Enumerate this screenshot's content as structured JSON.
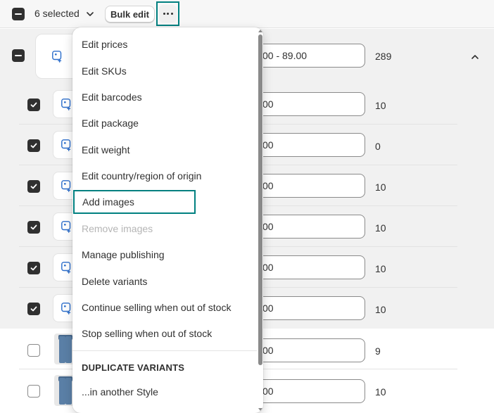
{
  "toolbar": {
    "selected_label": "6 selected",
    "bulk_edit_label": "Bulk edit"
  },
  "parent": {
    "price": "00 - 89.00",
    "qty": "289"
  },
  "variants": [
    {
      "checked": true,
      "image": "add-image",
      "price": "00",
      "qty": "10"
    },
    {
      "checked": true,
      "image": "add-image",
      "price": "00",
      "qty": "0"
    },
    {
      "checked": true,
      "image": "add-image",
      "price": "00",
      "qty": "10"
    },
    {
      "checked": true,
      "image": "add-image",
      "price": "00",
      "qty": "10"
    },
    {
      "checked": true,
      "image": "add-image",
      "price": "00",
      "qty": "10"
    },
    {
      "checked": true,
      "image": "add-image",
      "price": "00",
      "qty": "10"
    },
    {
      "checked": false,
      "image": "jeans-photo",
      "price": "00",
      "qty": "9"
    },
    {
      "checked": false,
      "image": "jeans-photo",
      "price": "00",
      "qty": "10"
    }
  ],
  "menu": {
    "items": [
      {
        "label": "Edit prices"
      },
      {
        "label": "Edit SKUs"
      },
      {
        "label": "Edit barcodes"
      },
      {
        "label": "Edit package"
      },
      {
        "label": "Edit weight"
      },
      {
        "label": "Edit country/region of origin"
      },
      {
        "label": "Add images"
      },
      {
        "label": "Remove images"
      },
      {
        "label": "Manage publishing"
      },
      {
        "label": "Delete variants"
      },
      {
        "label": "Continue selling when out of stock"
      },
      {
        "label": "Stop selling when out of stock"
      }
    ],
    "section_heading": "DUPLICATE VARIANTS",
    "section_items": [
      {
        "label": "...in another Style"
      }
    ]
  },
  "colors": {
    "highlight": "#008080",
    "text": "#303030",
    "disabled": "#b5b5b5",
    "row_selected_bg": "#f1f1f1"
  }
}
